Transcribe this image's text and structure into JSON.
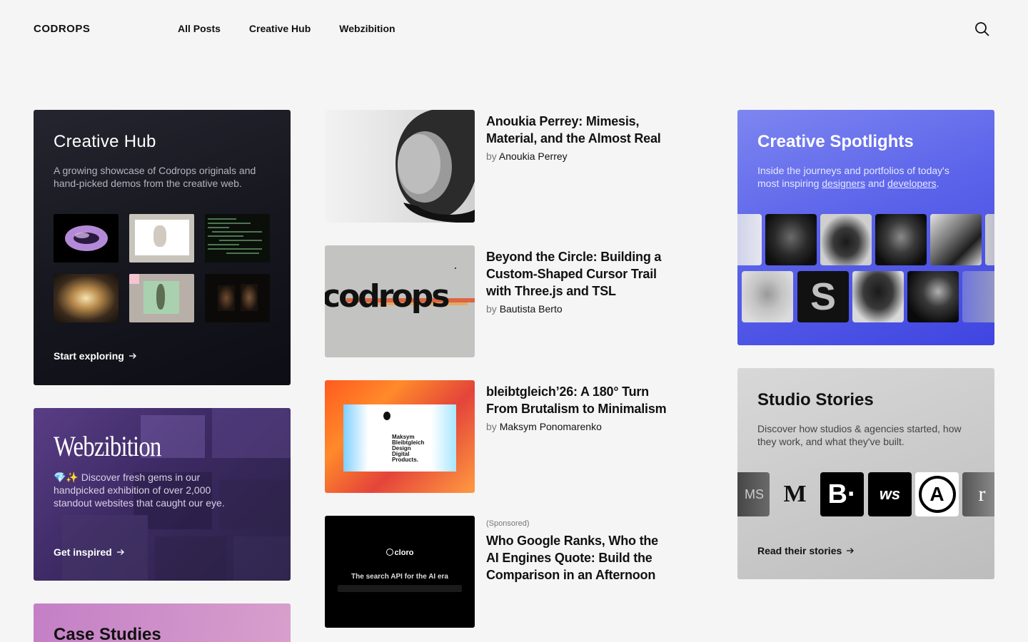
{
  "header": {
    "logo": "CODROPS",
    "nav": [
      "All Posts",
      "Creative Hub",
      "Webzibition"
    ],
    "search_icon": "search-icon"
  },
  "creative_hub": {
    "title": "Creative Hub",
    "description": "A growing showcase of Codrops originals and hand-picked demos from the creative web.",
    "cta": "Start exploring"
  },
  "webzibition": {
    "title": "Webzibition",
    "description": "💎✨ Discover fresh gems in our handpicked exhibition of over 2,000 standout websites that caught our eye.",
    "cta": "Get inspired"
  },
  "case_studies": {
    "title": "Case Studies"
  },
  "articles": [
    {
      "title": "Anoukia Perrey: Mimesis, Material, and the Almost Real",
      "by": "by",
      "author": "Anoukia Perrey"
    },
    {
      "title": "Beyond the Circle: Building a Custom-Shaped Cursor Trail with Three.js and TSL",
      "by": "by",
      "author": "Bautista Berto"
    },
    {
      "title": "bleibtgleich’26: A 180° Turn From Brutalism to Minimalism",
      "by": "by",
      "author": "Maksym Ponomarenko"
    },
    {
      "sponsored": "(Sponsored)",
      "title": "Who Google Ranks, Who the AI Engines Quote: Build the Comparison in an Afternoon"
    }
  ],
  "article_images": {
    "codrops_word": "codrops",
    "maksym_lines": [
      "Maksym",
      "Bleibtgleich",
      "Design",
      "Digital",
      "Products."
    ],
    "cloro_brand": "cloro",
    "cloro_tagline": "The search API for the AI era"
  },
  "spotlights": {
    "title": "Creative Spotlights",
    "desc_before": "Inside the journeys and portfolios of today's most inspiring ",
    "link1": "designers",
    "desc_mid": " and ",
    "link2": "developers",
    "desc_end": "."
  },
  "studio_stories": {
    "title": "Studio Stories",
    "description": "Discover how studios & agencies started, how they work, and what they've built.",
    "cta": "Read their stories",
    "logos": [
      "MS",
      "M",
      "B·",
      "ws",
      "A",
      "r"
    ]
  }
}
